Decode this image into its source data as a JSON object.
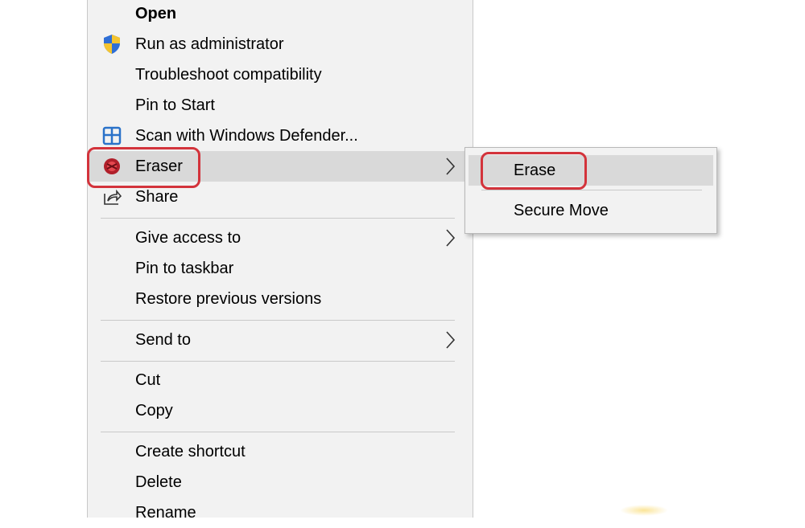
{
  "context_menu": {
    "items": [
      {
        "label": "Open",
        "bold": true
      },
      {
        "label": "Run as administrator",
        "icon": "uac-shield-icon"
      },
      {
        "label": "Troubleshoot compatibility"
      },
      {
        "label": "Pin to Start"
      },
      {
        "label": "Scan with Windows Defender...",
        "icon": "windows-defender-icon"
      },
      {
        "label": "Eraser",
        "icon": "eraser-icon",
        "submenu": true,
        "highlighted": true
      },
      {
        "label": "Share",
        "icon": "share-icon"
      },
      {
        "label": "Give access to",
        "submenu": true
      },
      {
        "label": "Pin to taskbar"
      },
      {
        "label": "Restore previous versions"
      },
      {
        "label": "Send to",
        "submenu": true
      },
      {
        "label": "Cut"
      },
      {
        "label": "Copy"
      },
      {
        "label": "Create shortcut"
      },
      {
        "label": "Delete"
      },
      {
        "label": "Rename"
      }
    ]
  },
  "eraser_submenu": {
    "items": [
      {
        "label": "Erase",
        "highlighted": true
      },
      {
        "label": "Secure Move"
      }
    ]
  },
  "colors": {
    "menu_background": "#f2f2f2",
    "hover_background": "#d9d9d9",
    "annotation_red": "#d3333b",
    "separator": "#c9c9c9"
  }
}
